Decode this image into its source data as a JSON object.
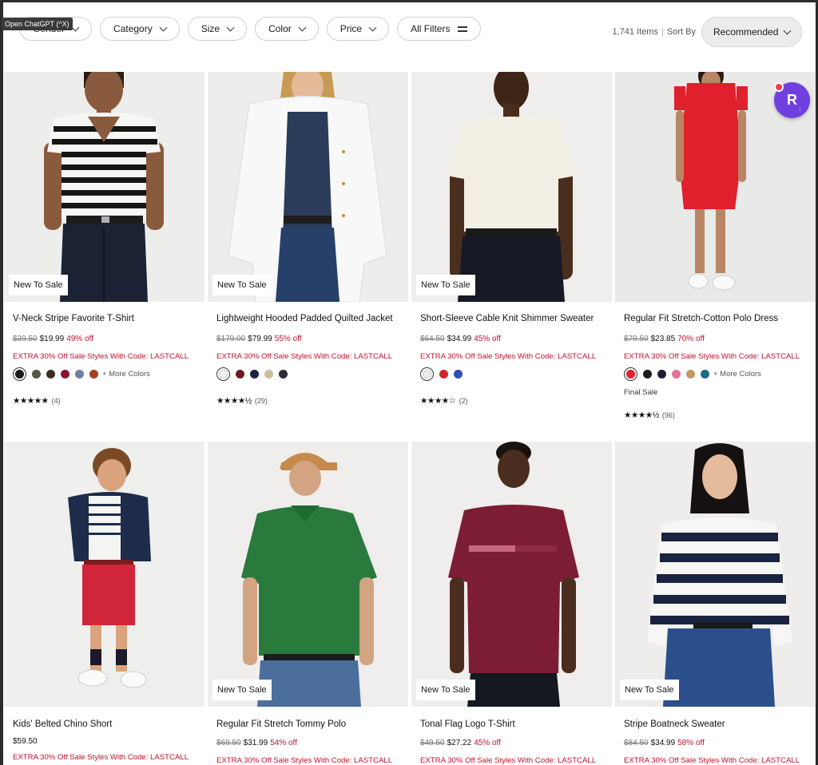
{
  "tooltip": "Open ChatGPT (^X)",
  "filters": [
    {
      "label": "Gender"
    },
    {
      "label": "Category"
    },
    {
      "label": "Size"
    },
    {
      "label": "Color"
    },
    {
      "label": "Price"
    }
  ],
  "all_filters_label": "All Filters",
  "items_count": "1,741 Items",
  "sort_by_label": "Sort By",
  "sort_value": "Recommended",
  "ext_badge": {
    "letter": "R",
    "colors": {
      "bg": "#6f3fe0"
    }
  },
  "colors": {
    "sale_red": "#c4102b",
    "text": "#1a1a1a",
    "muted": "#777777"
  },
  "products": [
    {
      "badge": "New To Sale",
      "title": "V-Neck Stripe Favorite T-Shirt",
      "orig_price": "$39.50",
      "sale_price": "$19.99",
      "off": "49% off",
      "promo": "EXTRA 30% Off Sale Styles With Code: LASTCALL",
      "swatches": [
        "#1a1a1a",
        "#5a5444",
        "#3a3020",
        "#8a1330",
        "#6e7fa6",
        "#a84020"
      ],
      "more_colors": "+ More Colors",
      "final_sale": "",
      "stars": "★★★★★",
      "reviews": "(4)"
    },
    {
      "badge": "New To Sale",
      "title": "Lightweight Hooded Padded Quilted Jacket",
      "orig_price": "$179.00",
      "sale_price": "$79.99",
      "off": "55% off",
      "promo": "EXTRA 30% Off Sale Styles With Code: LASTCALL",
      "swatches": [
        "#f2f2f2",
        "#6e1a24",
        "#1c2540",
        "#cdbf9f",
        "#2a2c38"
      ],
      "more_colors": "",
      "final_sale": "",
      "stars": "★★★★½",
      "reviews": "(29)"
    },
    {
      "badge": "New To Sale",
      "title": "Short-Sleeve Cable Knit Shimmer Sweater",
      "orig_price": "$64.50",
      "sale_price": "$34.99",
      "off": "45% off",
      "promo": "EXTRA 30% Off Sale Styles With Code: LASTCALL",
      "swatches": [
        "#efeee6",
        "#d1262e",
        "#2d4fb8"
      ],
      "more_colors": "",
      "final_sale": "",
      "stars": "★★★★☆",
      "reviews": "(2)"
    },
    {
      "badge": "",
      "title": "Regular Fit Stretch-Cotton Polo Dress",
      "orig_price": "$79.50",
      "sale_price": "$23.85",
      "off": "70% off",
      "promo": "EXTRA 30% Off Sale Styles With Code: LASTCALL",
      "swatches": [
        "#e1232f",
        "#1a1a1a",
        "#1b1f36",
        "#e97296",
        "#c39a5e",
        "#1a6b84"
      ],
      "more_colors": "+ More Colors",
      "final_sale": "Final Sale",
      "stars": "★★★★½",
      "reviews": "(96)"
    },
    {
      "badge": "",
      "title": "Kids' Belted Chino Short",
      "orig_price": "",
      "sale_price": "$59.50",
      "off": "",
      "promo": "EXTRA 30% Off Sale Styles With Code: LASTCALL"
    },
    {
      "badge": "New To Sale",
      "title": "Regular Fit Stretch Tommy Polo",
      "orig_price": "$69.50",
      "sale_price": "$31.99",
      "off": "54% off",
      "promo": "EXTRA 30% Off Sale Styles With Code: LASTCALL"
    },
    {
      "badge": "New To Sale",
      "title": "Tonal Flag Logo T-Shirt",
      "orig_price": "$49.50",
      "sale_price": "$27.22",
      "off": "45% off",
      "promo": "EXTRA 30% Off Sale Styles With Code: LASTCALL"
    },
    {
      "badge": "New To Sale",
      "title": "Stripe Boatneck Sweater",
      "orig_price": "$84.50",
      "sale_price": "$34.99",
      "off": "58% off",
      "promo": "EXTRA 30% Off Sale Styles With Code: LASTCALL"
    }
  ]
}
